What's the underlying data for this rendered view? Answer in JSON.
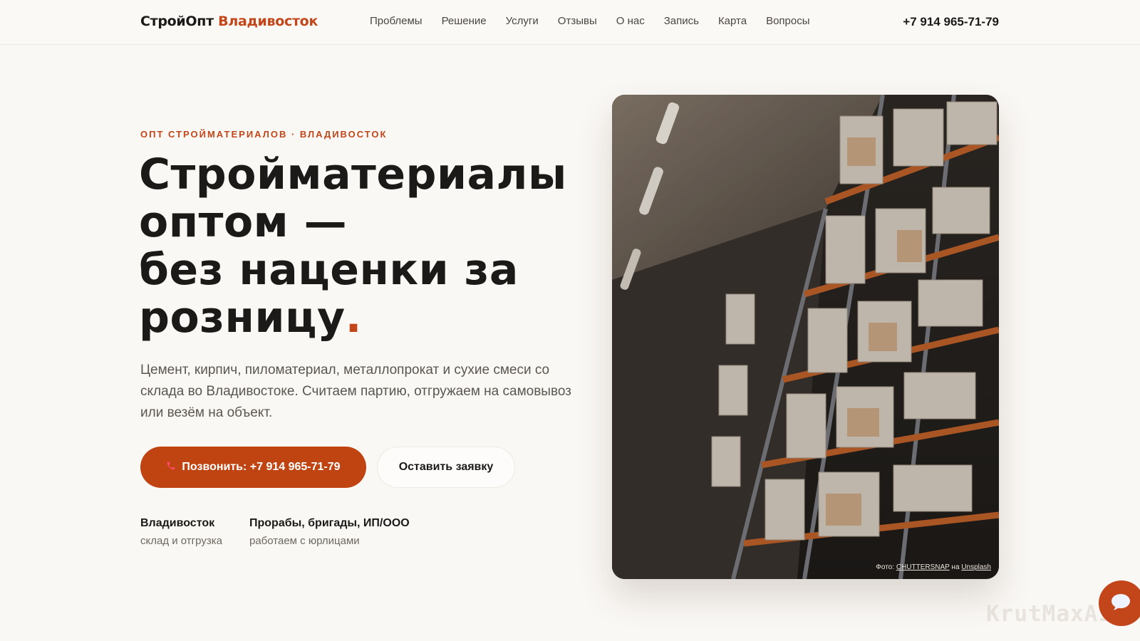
{
  "header": {
    "logo_main": "СтройОпт",
    "logo_accent": "Владивосток",
    "nav": [
      "Проблемы",
      "Решение",
      "Услуги",
      "Отзывы",
      "О нас",
      "Запись",
      "Карта",
      "Вопросы"
    ],
    "phone": "+7 914 965-71-79"
  },
  "hero": {
    "kicker": "ОПТ СТРОЙМАТЕРИАЛОВ · ВЛАДИВОСТОК",
    "headline_line1": "Стройматериалы",
    "headline_line2": "оптом —",
    "headline_line3": "без наценки за",
    "headline_line4": "розницу",
    "headline_dot": ".",
    "lead": "Цемент, кирпич, пиломатериал, металлопрокат и сухие смеси со склада во Владивостоке. Считаем партию, отгружаем на самовывоз или везём на объект.",
    "call_button": "Позвонить: +7 914 965-71-79",
    "call_icon": "phone-icon",
    "request_button": "Оставить заявку",
    "facts": [
      {
        "title": "Владивосток",
        "sub": "склад и отгрузка"
      },
      {
        "title": "Прорабы, бригады, ИП/ООО",
        "sub": "работаем с юрлицами"
      }
    ]
  },
  "photo": {
    "credit_prefix": "Фото:",
    "credit_author": "CHUTTERSNAP",
    "credit_mid": "на",
    "credit_source": "Unsplash"
  },
  "chat": {
    "icon": "chat-bubble-icon"
  },
  "watermark": "KrutMaxAI",
  "colors": {
    "accent": "#c2461a",
    "button": "#bf4412",
    "background": "#faf8f5",
    "text": "#1c1a18"
  }
}
